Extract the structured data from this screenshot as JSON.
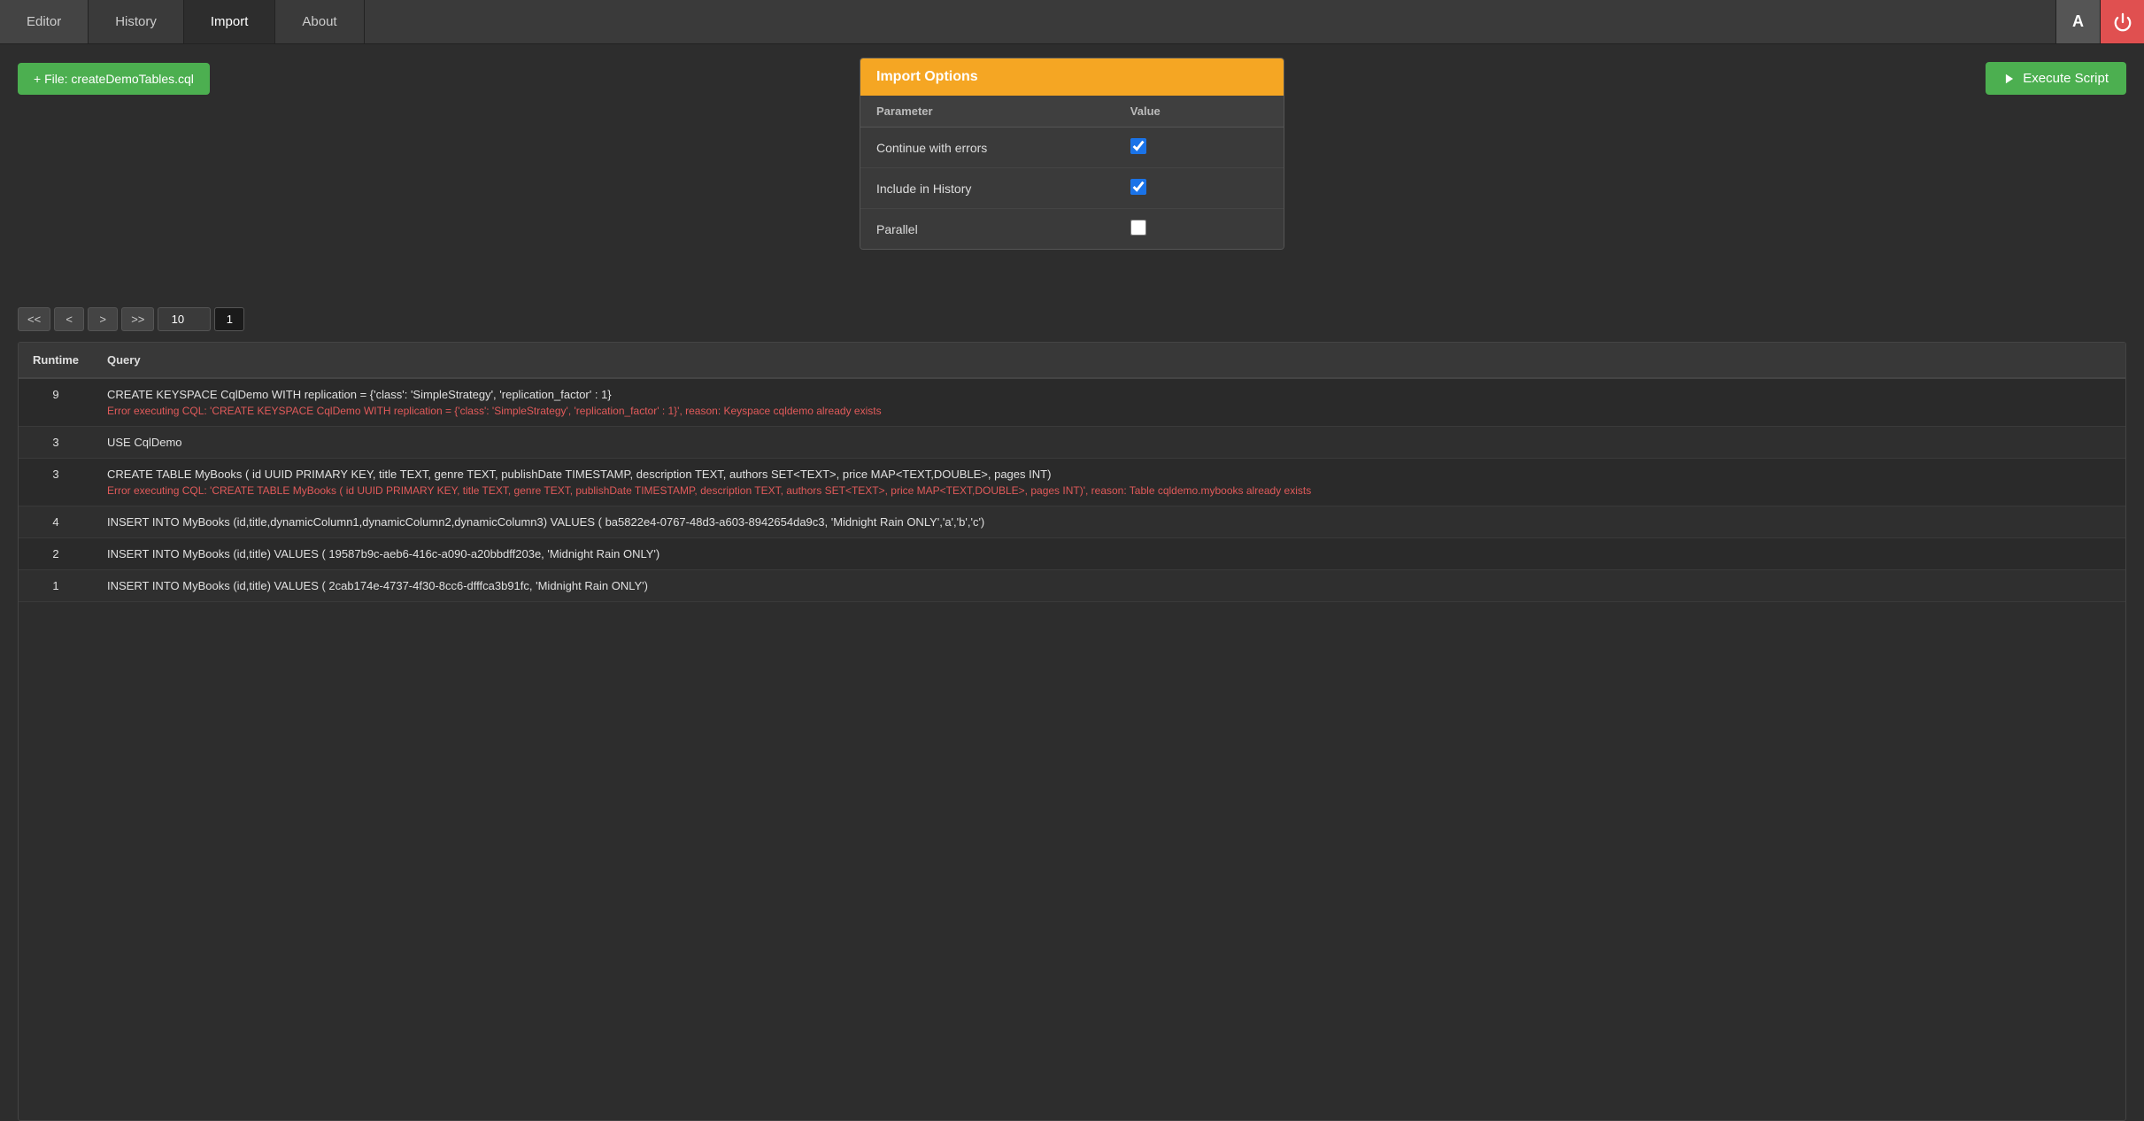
{
  "nav": {
    "tabs": [
      {
        "id": "editor",
        "label": "Editor",
        "active": false
      },
      {
        "id": "history",
        "label": "History",
        "active": false
      },
      {
        "id": "import",
        "label": "Import",
        "active": true
      },
      {
        "id": "about",
        "label": "About",
        "active": false
      }
    ],
    "alert_icon": "alert-icon",
    "power_icon": "power-icon"
  },
  "file_button": {
    "label": "+ File: createDemoTables.cql"
  },
  "execute_button": {
    "label": "Execute Script"
  },
  "import_options": {
    "title": "Import Options",
    "columns": [
      "Parameter",
      "Value"
    ],
    "rows": [
      {
        "parameter": "Continue with errors",
        "checked": true
      },
      {
        "parameter": "Include in History",
        "checked": true
      },
      {
        "parameter": "Parallel",
        "checked": false
      }
    ]
  },
  "pagination": {
    "first": "<<",
    "prev": "<",
    "next": ">",
    "last": ">>",
    "per_page": "10",
    "current_page": "1"
  },
  "results": {
    "columns": [
      "Runtime",
      "Query"
    ],
    "rows": [
      {
        "runtime": "9",
        "query": "CREATE KEYSPACE CqlDemo WITH replication = {'class': 'SimpleStrategy', 'replication_factor' : 1}",
        "error": "Error executing CQL: 'CREATE KEYSPACE CqlDemo WITH replication = {'class': 'SimpleStrategy', 'replication_factor' : 1}', reason: Keyspace cqldemo already exists"
      },
      {
        "runtime": "3",
        "query": "USE CqlDemo",
        "error": ""
      },
      {
        "runtime": "3",
        "query": "CREATE TABLE MyBooks ( id UUID PRIMARY KEY, title TEXT, genre TEXT, publishDate TIMESTAMP, description TEXT, authors SET<TEXT>, price MAP<TEXT,DOUBLE>, pages INT)",
        "error": "Error executing CQL: 'CREATE TABLE MyBooks ( id UUID PRIMARY KEY, title TEXT, genre TEXT, publishDate TIMESTAMP, description TEXT, authors SET<TEXT>, price MAP<TEXT,DOUBLE>, pages INT)', reason: Table cqldemo.mybooks already exists"
      },
      {
        "runtime": "4",
        "query": "INSERT INTO MyBooks (id,title,dynamicColumn1,dynamicColumn2,dynamicColumn3) VALUES ( ba5822e4-0767-48d3-a603-8942654da9c3, 'Midnight Rain ONLY','a','b','c')",
        "error": ""
      },
      {
        "runtime": "2",
        "query": "INSERT INTO MyBooks (id,title) VALUES ( 19587b9c-aeb6-416c-a090-a20bbdff203e, 'Midnight Rain ONLY')",
        "error": ""
      },
      {
        "runtime": "1",
        "query": "INSERT INTO MyBooks (id,title) VALUES ( 2cab174e-4737-4f30-8cc6-dfffca3b91fc, 'Midnight Rain ONLY')",
        "error": ""
      }
    ]
  }
}
